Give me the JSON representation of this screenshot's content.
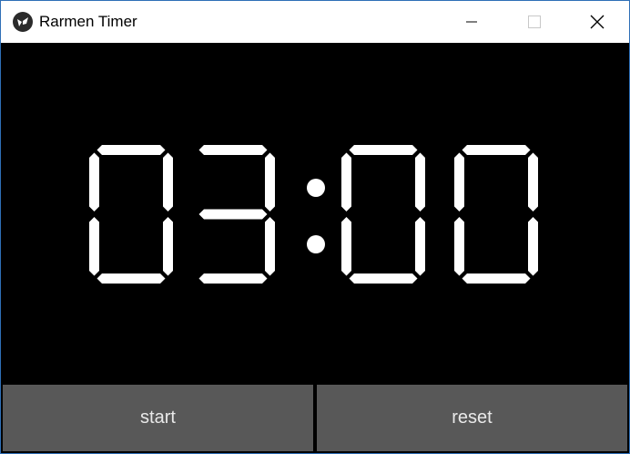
{
  "window": {
    "title": "Rarmen Timer",
    "icon": "kivy-logo-icon",
    "controls": [
      "minimize-icon",
      "maximize-icon",
      "close-icon"
    ]
  },
  "timer": {
    "display": "03:00",
    "color": "#ffffff",
    "background": "#000000"
  },
  "buttons": {
    "start_label": "start",
    "reset_label": "reset",
    "color": "#585858"
  }
}
